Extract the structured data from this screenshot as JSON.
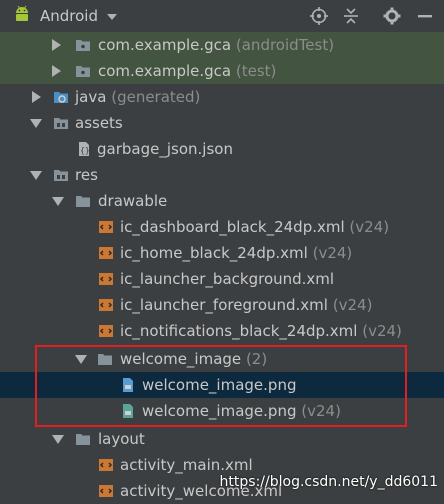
{
  "toolbar": {
    "title": "Android",
    "icons": [
      "android-icon",
      "dropdown-caret-icon",
      "locate-icon",
      "collapse-all-icon",
      "settings-gear-icon",
      "hide-panel-icon"
    ]
  },
  "tree": {
    "pkg_android_test": {
      "label": "com.example.gca",
      "suffix": "(androidTest)"
    },
    "pkg_test": {
      "label": "com.example.gca",
      "suffix": "(test)"
    },
    "java_generated": {
      "label": "java",
      "suffix": "(generated)"
    },
    "assets": {
      "label": "assets"
    },
    "garbage_json": {
      "label": "garbage_json.json"
    },
    "res": {
      "label": "res"
    },
    "drawable": {
      "label": "drawable"
    },
    "ic_dashboard": {
      "label": "ic_dashboard_black_24dp.xml",
      "suffix": "(v24)"
    },
    "ic_home": {
      "label": "ic_home_black_24dp.xml",
      "suffix": "(v24)"
    },
    "ic_launcher_background": {
      "label": "ic_launcher_background.xml"
    },
    "ic_launcher_foreground": {
      "label": "ic_launcher_foreground.xml",
      "suffix": "(v24)"
    },
    "ic_notifications": {
      "label": "ic_notifications_black_24dp.xml",
      "suffix": "(v24)"
    },
    "welcome_image_folder": {
      "label": "welcome_image",
      "suffix": "(2)"
    },
    "welcome_png": {
      "label": "welcome_image.png"
    },
    "welcome_png_v24": {
      "label": "welcome_image.png",
      "suffix": "(v24)"
    },
    "layout": {
      "label": "layout"
    },
    "activity_main": {
      "label": "activity_main.xml"
    },
    "activity_welcome": {
      "label": "activity_welcome.xml"
    }
  },
  "watermark": "https://blog.csdn.net/y_dd6011",
  "colors": {
    "background": "#3c3f41",
    "highlight_green": "#435540",
    "selection_blue": "#0d293e",
    "annotation_red": "#e02020",
    "android_green": "#a4c639",
    "xml_orange": "#cc7832"
  }
}
